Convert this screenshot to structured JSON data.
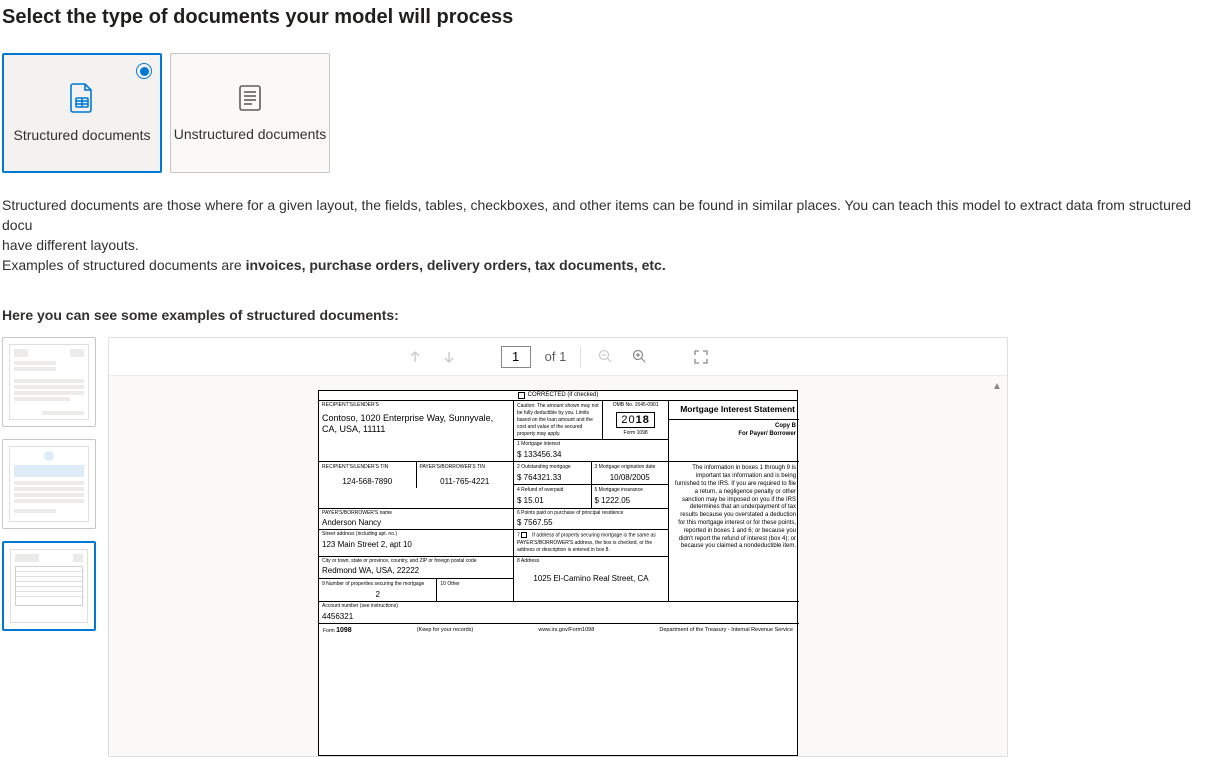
{
  "title": "Select the type of documents your model will process",
  "cards": {
    "structured": "Structured documents",
    "unstructured": "Unstructured documents"
  },
  "description": {
    "line1": "Structured documents are those where for a given layout, the fields, tables, checkboxes, and other items can be found in similar places. You can teach this model to extract data from structured docu",
    "line2": "have different layouts.",
    "line3_pre": "Examples of structured documents are ",
    "line3_bold": "invoices, purchase orders, delivery orders, tax documents, etc."
  },
  "examples_heading": "Here you can see some examples of structured documents:",
  "viewer": {
    "page_current": "1",
    "page_of": "of 1"
  },
  "form1098": {
    "corrected": "CORRECTED (if checked)",
    "recip_lender_label": "RECIPIENT'S/LENDER'S",
    "recip_lender_name": "Contoso, 1020 Enterprise Way, Sunnyvale, CA, USA, 11111",
    "caution": "Caution: The amount shown may not be fully deductible by you. Limits based on the loan amount and the cost and value of the secured property may apply.",
    "omb": "OMB No. 1545-0901",
    "year_light": "20",
    "year_bold": "18",
    "form_no": "Form 1098",
    "title": "Mortgage Interest Statement",
    "box1_lbl": "1 Mortgage interest",
    "box1_val": "$ 133456.34",
    "copy_b": "Copy B",
    "for_payer": "For Payer/ Borrower",
    "recip_tin_lbl": "RECIPIENT'S/LENDER'S TIN",
    "recip_tin": "124-568-7890",
    "payer_tin_lbl": "PAYER'S/BORROWER'S TIN",
    "payer_tin": "011-765-4221",
    "box2_lbl": "2 Outstanding mortgage",
    "box2_val": "$ 764321.33",
    "box3_lbl": "3 Mortgage origination date",
    "box3_val": "10/08/2005",
    "box4_lbl": "4 Refund of overpaid",
    "box4_val": "$ 15.01",
    "box5_lbl": "5 Mortgage insurance",
    "box5_val": "$ 1222.05",
    "box6_lbl": "6 Points paid on purchase of principal residence",
    "box6_val": "$ 7567.55",
    "payer_name_lbl": "PAYER'S/BORROWER'S name",
    "payer_name": "Anderson Nancy",
    "street_lbl": "Street address (including apt. no.)",
    "street": "123 Main Street 2, apt 10",
    "city_lbl": "City or town, state or province, country, and ZIP or foreign postal code",
    "city": "Redmond WA, USA, 22222",
    "box7_lbl": "7",
    "box7_text": "If address of property securing mortgage is the same as PAYER'S/BORROWER'S address, the box is checked, or the address or description is entered in box 8.",
    "box8_lbl": "8 Address",
    "box8_val": "1025 El-Camino Real Street, CA",
    "box9_lbl": "9 Number of properties securing the mortgage",
    "box9_val": "2",
    "box10_lbl": "10 Other",
    "acct_lbl": "Account number (see instructions)",
    "acct": "4456321",
    "footer_form": "Form 1098",
    "footer_keep": "(Keep for your records)",
    "footer_url": "www.irs.gov/Form1098",
    "footer_dept": "Department of the Treasury - Internal Revenue Service",
    "instructions": "The information in boxes 1 through 9 is important tax information and is being furnished to the IRS. If you are required to file a return, a negligence penalty or other sanction may be imposed on you if the IRS determines that an underpayment of tax results because you overstated a deduction for this mortgage interest or for these points, reported in boxes 1 and 6; or because you didn't report the refund of interest (box 4); or because you claimed a nondeductible item."
  }
}
